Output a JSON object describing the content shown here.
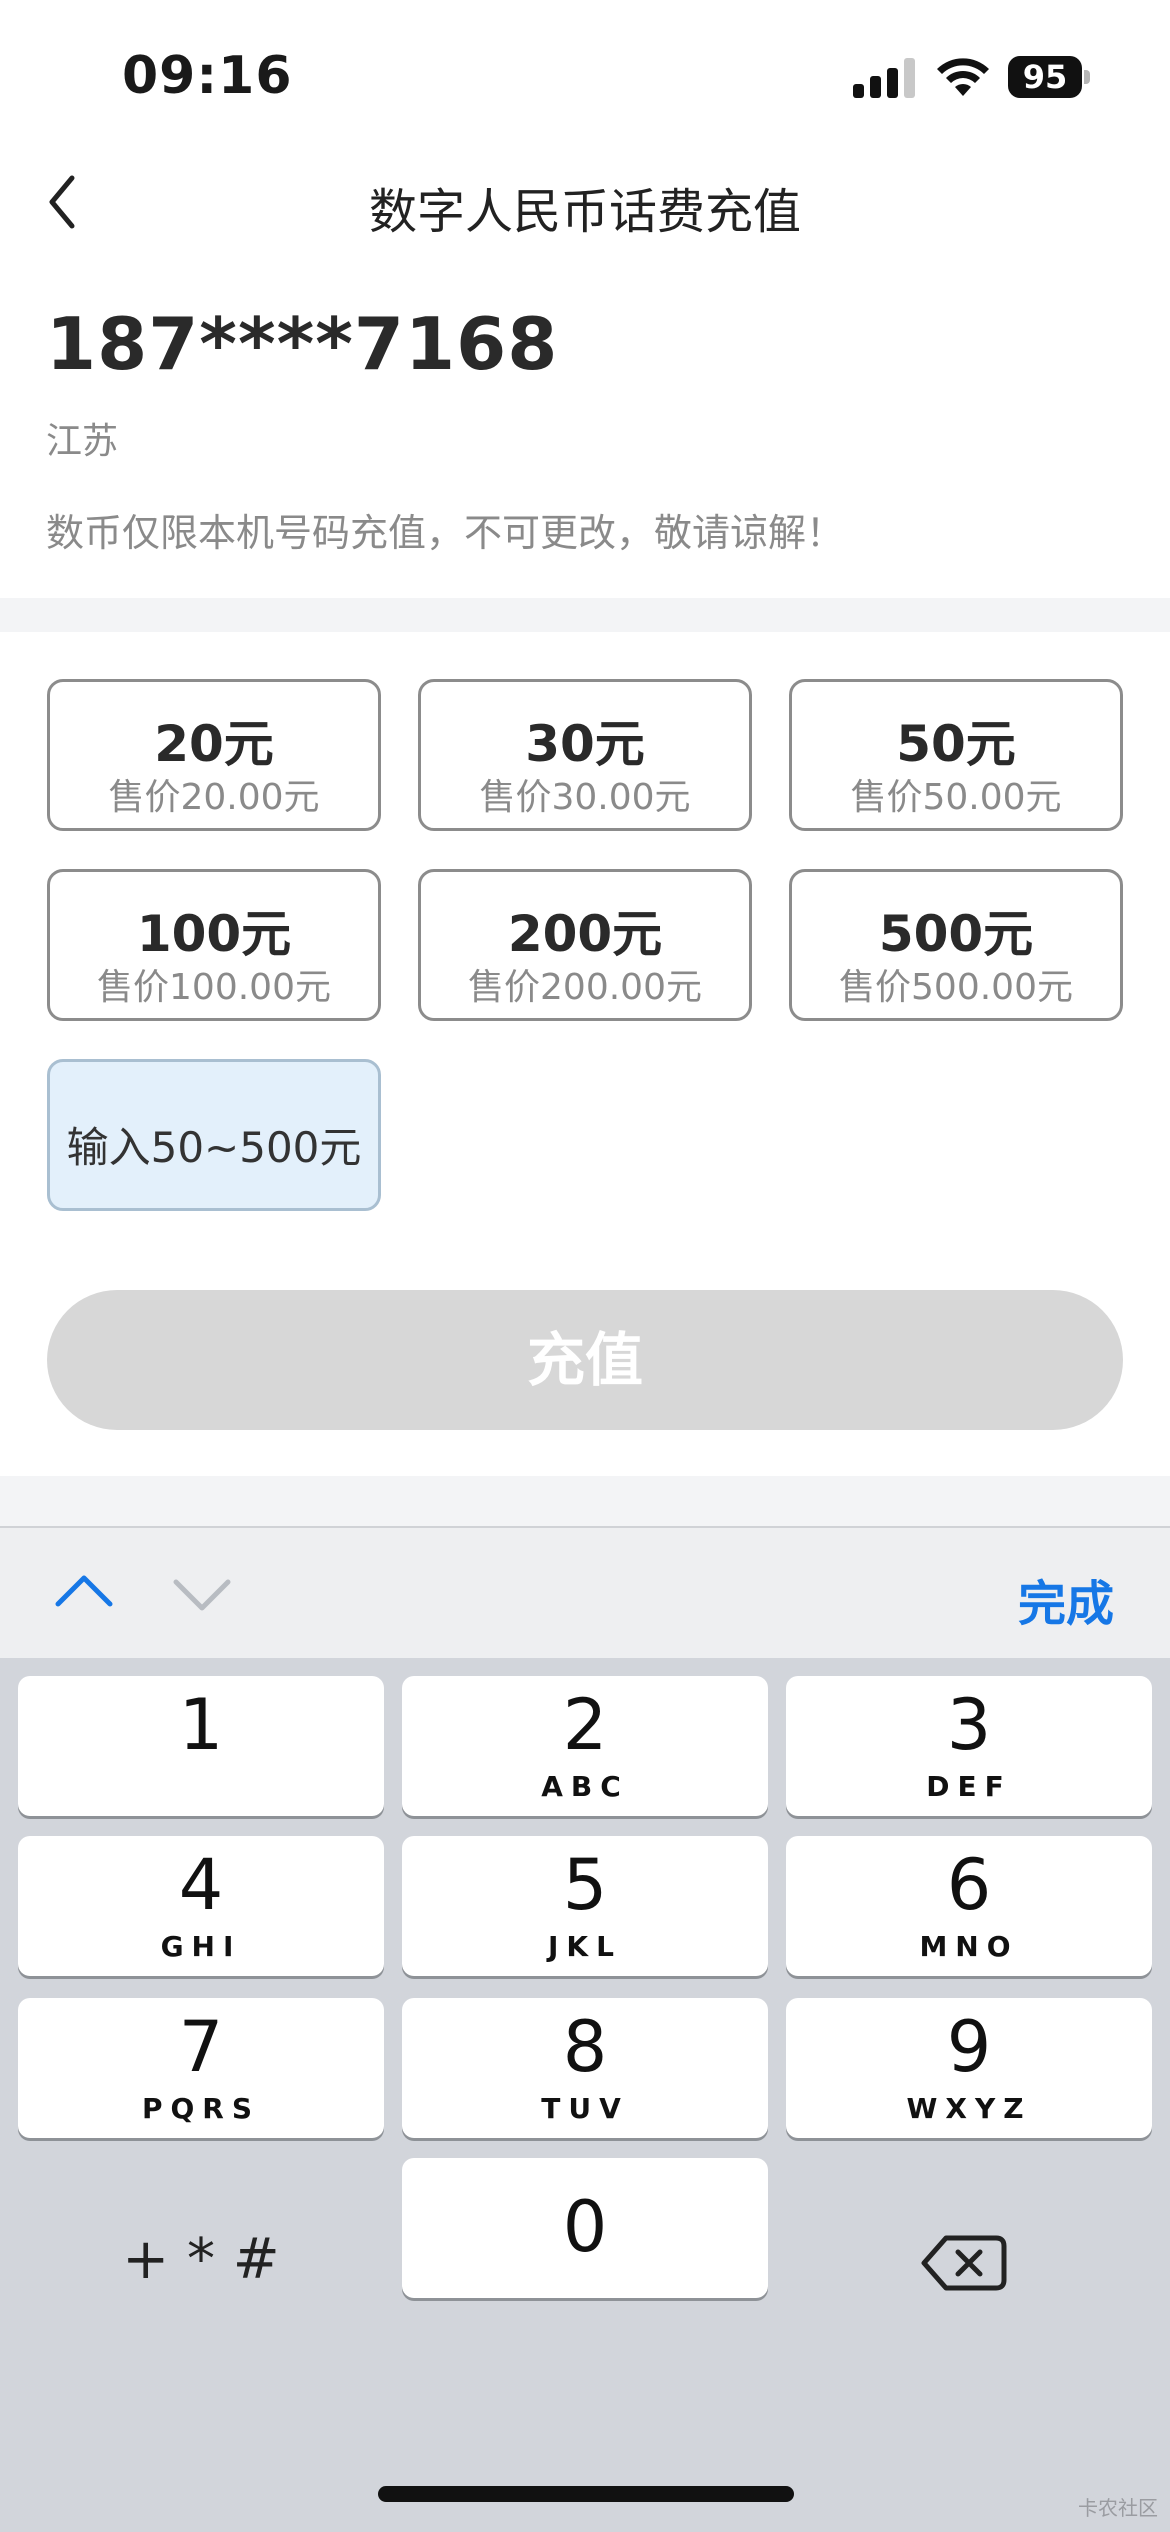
{
  "status_bar": {
    "time": "09:16",
    "battery": "95",
    "icons": [
      "cellular-signal-icon",
      "wifi-icon",
      "battery-icon"
    ]
  },
  "header": {
    "back_icon": "chevron-left-icon",
    "title": "数字人民币话费充值"
  },
  "phone": {
    "number": "187****7168",
    "region": "江苏",
    "notice": "数币仅限本机号码充值，不可更改，敬请谅解！"
  },
  "denominations": [
    {
      "amount": "20元",
      "price": "售价20.00元"
    },
    {
      "amount": "30元",
      "price": "售价30.00元"
    },
    {
      "amount": "50元",
      "price": "售价50.00元"
    },
    {
      "amount": "100元",
      "price": "售价100.00元"
    },
    {
      "amount": "200元",
      "price": "售价200.00元"
    },
    {
      "amount": "500元",
      "price": "售价500.00元"
    }
  ],
  "custom_amount": {
    "placeholder": "输入50~500元"
  },
  "recharge_button": "充值",
  "keyboard_toolbar": {
    "prev_icon": "chevron-up-icon",
    "next_icon": "chevron-down-icon",
    "done": "完成"
  },
  "keypad": [
    {
      "num": "1",
      "letters": ""
    },
    {
      "num": "2",
      "letters": "ABC"
    },
    {
      "num": "3",
      "letters": "DEF"
    },
    {
      "num": "4",
      "letters": "GHI"
    },
    {
      "num": "5",
      "letters": "JKL"
    },
    {
      "num": "6",
      "letters": "MNO"
    },
    {
      "num": "7",
      "letters": "PQRS"
    },
    {
      "num": "8",
      "letters": "TUV"
    },
    {
      "num": "9",
      "letters": "WXYZ"
    },
    {
      "num": "0",
      "letters": ""
    }
  ],
  "symbols_key": "+ * #",
  "backspace_icon": "backspace-icon",
  "watermark": "卡农社区",
  "colors": {
    "accent": "#1677e6",
    "selected_bg": "#e3f0fb",
    "disabled_button": "#d7d7d7",
    "keyboard_bg": "#d2d5db"
  }
}
